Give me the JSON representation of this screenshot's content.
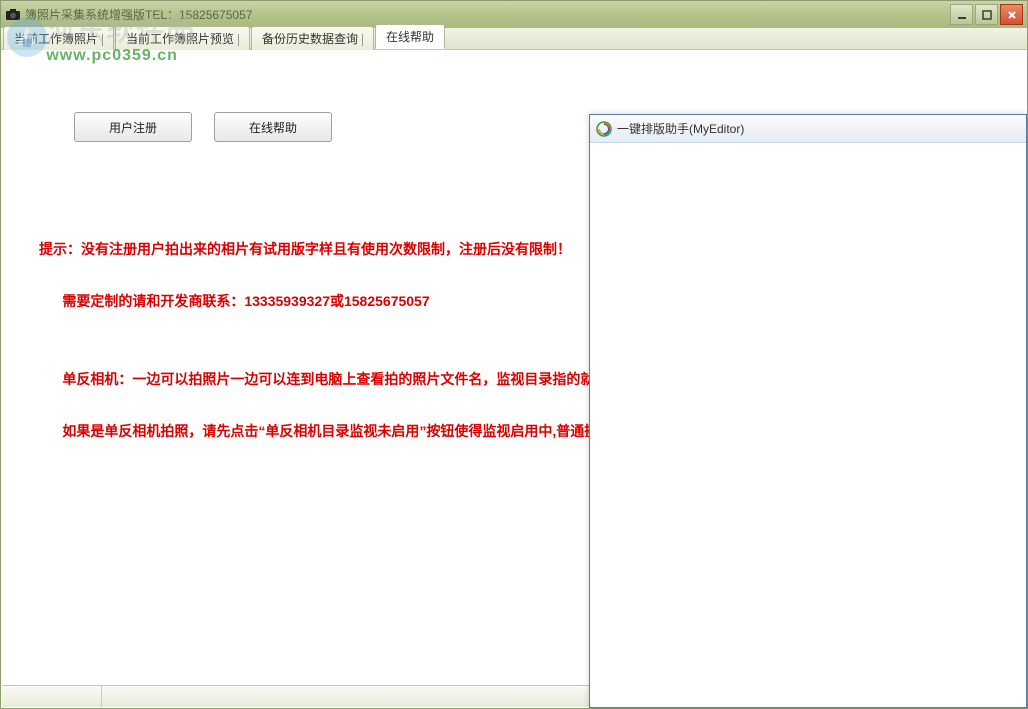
{
  "main_window": {
    "title": "簿照片采集系统增强版TEL：15825675057",
    "tabs": [
      {
        "label": "当前工作簿照片"
      },
      {
        "label": "当前工作簿照片预览"
      },
      {
        "label": "备份历史数据查询"
      },
      {
        "label": "在线帮助",
        "active": true
      }
    ],
    "buttons": {
      "register": "用户注册",
      "online_help": "在线帮助"
    },
    "hint": {
      "line1": "提示：没有注册用户拍出来的相片有试用版字样且有使用次数限制，注册后没有限制！",
      "line2": "      需要定制的请和开发商联系：13335939327或15825675057",
      "line3": "",
      "line4": "      单反相机：一边可以拍照片一边可以连到电脑上查看拍的照片文件名，监视目录指的就是这个目录！",
      "line5": "      如果是单反相机拍照，请先点击“单反相机目录监视未启用”按钮使得监视启用中,普通摄像头拍照就不用点击此按钮了！"
    }
  },
  "overlay": {
    "title": "一键排版助手(MyEditor)"
  },
  "watermark": {
    "cn": "河东软件园",
    "url": "www.pc0359.cn"
  }
}
